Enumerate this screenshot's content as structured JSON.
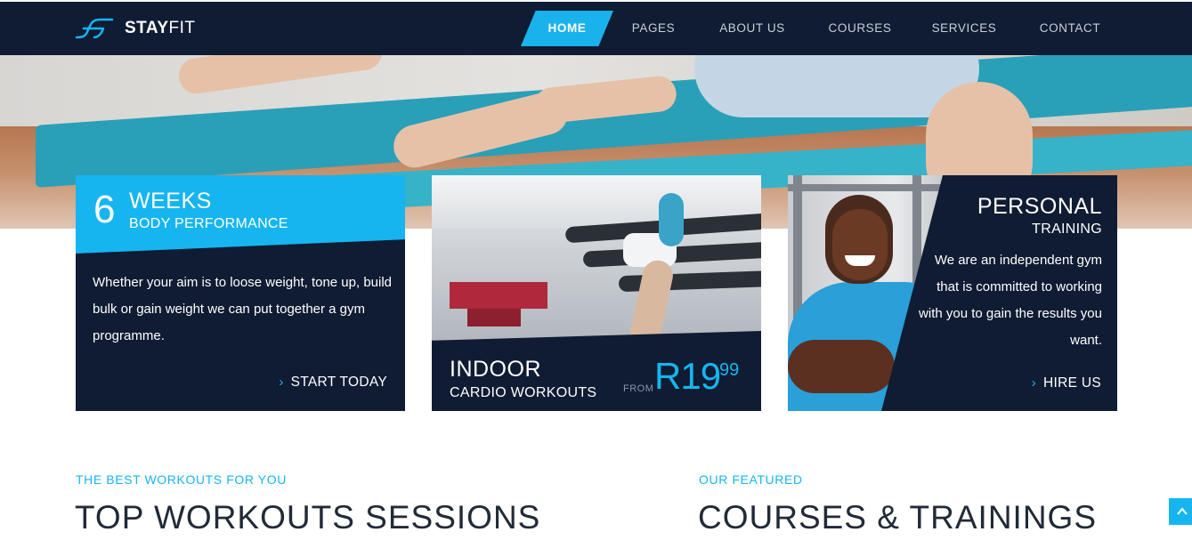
{
  "brand": {
    "name_bold": "STAY",
    "name_light": "FIT"
  },
  "nav": {
    "items": [
      {
        "label": "HOME",
        "active": true
      },
      {
        "label": "PAGES",
        "active": false
      },
      {
        "label": "ABOUT US",
        "active": false
      },
      {
        "label": "COURSES",
        "active": false
      },
      {
        "label": "SERVICES",
        "active": false
      },
      {
        "label": "CONTACT",
        "active": false
      }
    ]
  },
  "cards": {
    "weeks": {
      "number": "6",
      "title": "WEEKS",
      "subtitle": "BODY PERFORMANCE",
      "body": "Whether your aim is to loose weight, tone up, build bulk or gain weight we can put together a gym programme.",
      "cta": "START TODAY"
    },
    "indoor": {
      "title": "INDOOR",
      "subtitle": "CARDIO WORKOUTS",
      "from_label": "FROM",
      "price_main": "R19",
      "price_cents": "99"
    },
    "personal": {
      "title": "PERSONAL",
      "subtitle": "TRAINING",
      "body": "We are an independent gym that is committed to working with you to gain the results you want.",
      "cta": "HIRE US"
    }
  },
  "sections": {
    "workouts": {
      "eyebrow": "THE BEST WORKOUTS FOR YOU",
      "title": "TOP WORKOUTS SESSIONS"
    },
    "courses": {
      "eyebrow": "OUR FEATURED",
      "title": "COURSES & TRAININGS"
    }
  },
  "colors": {
    "navy": "#0f1c33",
    "accent": "#16b5f0"
  },
  "icons": {
    "scroll_top": "chevron-up-icon",
    "cta": "chevron-right-icon"
  }
}
